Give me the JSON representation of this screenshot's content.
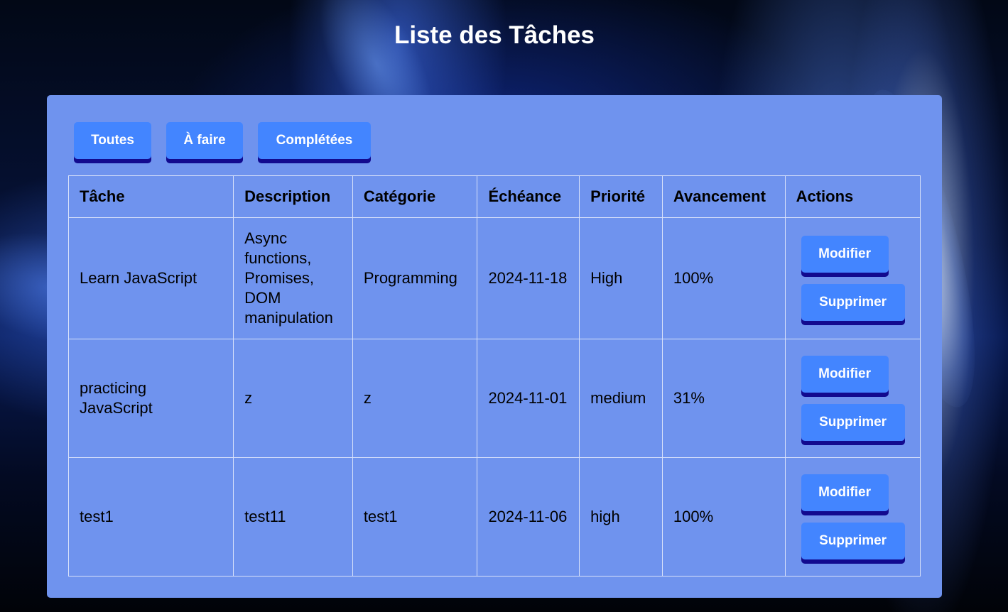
{
  "page": {
    "title": "Liste des Tâches"
  },
  "filters": [
    {
      "label": "Toutes"
    },
    {
      "label": "À faire"
    },
    {
      "label": "Complétées"
    }
  ],
  "table": {
    "headers": [
      "Tâche",
      "Description",
      "Catégorie",
      "Échéance",
      "Priorité",
      "Avancement",
      "Actions"
    ],
    "rows": [
      {
        "task": "Learn JavaScript",
        "description": "Async functions, Promises, DOM manipulation",
        "category": "Programming",
        "due": "2024-11-18",
        "priority": "High",
        "progress": "100%",
        "edit_label": "Modifier",
        "delete_label": "Supprimer"
      },
      {
        "task": "practicing JavaScript",
        "description": "z",
        "category": "z",
        "due": "2024-11-01",
        "priority": "medium",
        "progress": "31%",
        "edit_label": "Modifier",
        "delete_label": "Supprimer"
      },
      {
        "task": "test1",
        "description": "test11",
        "category": "test1",
        "due": "2024-11-06",
        "priority": "high",
        "progress": "100%",
        "edit_label": "Modifier",
        "delete_label": "Supprimer"
      }
    ]
  },
  "colors": {
    "panel": "#6f93ee",
    "button": "#4385ff",
    "button_shadow": "#120a8f",
    "title_text": "#ffffff"
  }
}
